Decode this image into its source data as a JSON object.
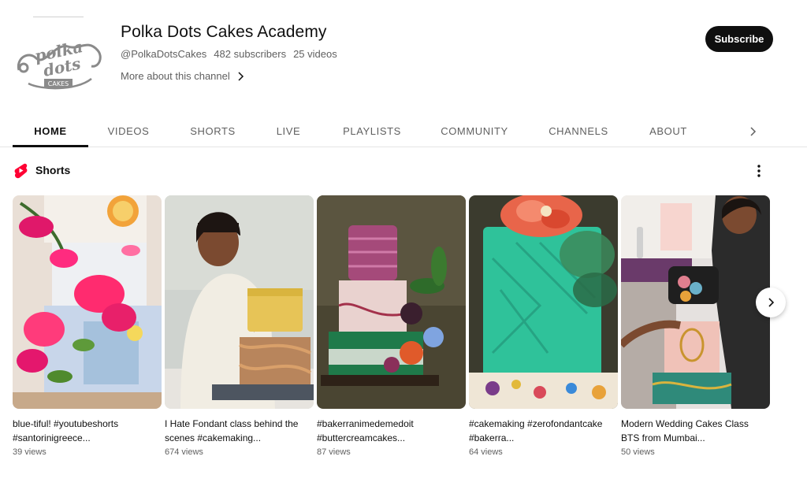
{
  "channel": {
    "name": "Polka Dots Cakes Academy",
    "handle": "@PolkaDotsCakes",
    "subscribers": "482 subscribers",
    "videos": "25 videos",
    "more_about": "More about this channel",
    "subscribe_label": "Subscribe",
    "avatar_logo_text": "polka dots",
    "avatar_logo_subtext": "CAKES"
  },
  "tabs": [
    {
      "label": "HOME",
      "active": true
    },
    {
      "label": "VIDEOS",
      "active": false
    },
    {
      "label": "SHORTS",
      "active": false
    },
    {
      "label": "LIVE",
      "active": false
    },
    {
      "label": "PLAYLISTS",
      "active": false
    },
    {
      "label": "COMMUNITY",
      "active": false
    },
    {
      "label": "CHANNELS",
      "active": false
    },
    {
      "label": "ABOUT",
      "active": false
    }
  ],
  "shorts_section": {
    "title": "Shorts",
    "items": [
      {
        "title": "blue-tiful! #youtubeshorts #santorinigreece...",
        "views": "39 views"
      },
      {
        "title": "I Hate Fondant class behind the scenes #cakemaking...",
        "views": "674 views"
      },
      {
        "title": "#bakerranimedemedoit #buttercreamcakes...",
        "views": "87 views"
      },
      {
        "title": "#cakemaking #zerofondantcake #bakerra...",
        "views": "64 views"
      },
      {
        "title": "Modern Wedding Cakes Class BTS from Mumbai...",
        "views": "50 views"
      }
    ]
  },
  "colors": {
    "accent": "#0f0f0f",
    "shorts_red": "#ff0033",
    "secondary_text": "#606060"
  }
}
